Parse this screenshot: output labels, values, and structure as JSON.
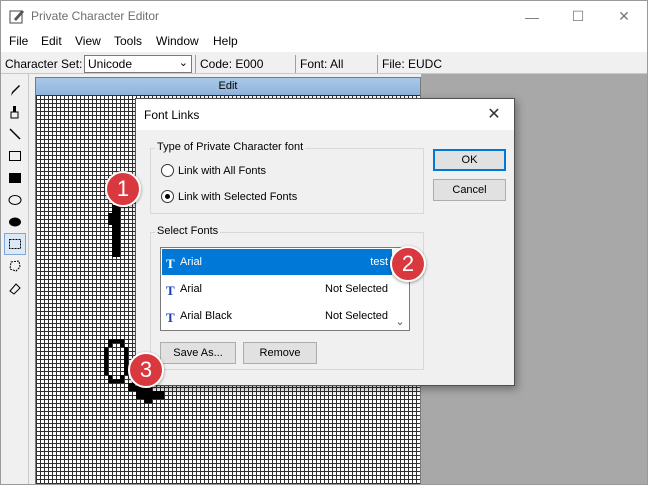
{
  "window": {
    "title": "Private Character Editor",
    "controls": {
      "minimize": "—",
      "maximize": "☐",
      "close": "✕"
    }
  },
  "menu": [
    "File",
    "Edit",
    "View",
    "Tools",
    "Window",
    "Help"
  ],
  "status_bar": {
    "charset_label": "Character Set:",
    "charset_value": "Unicode",
    "code": "Code: E000",
    "font": "Font: All",
    "file": "File: EUDC"
  },
  "tools": [
    "pencil-icon",
    "brush-icon",
    "line-icon",
    "hollow-rectangle-icon",
    "filled-rectangle-icon",
    "hollow-ellipse-icon",
    "filled-ellipse-icon",
    "rectangular-selection-icon",
    "freeform-selection-icon",
    "eraser-icon"
  ],
  "editor": {
    "header": "Edit"
  },
  "dialog": {
    "title": "Font Links",
    "close": "✕",
    "type_group": {
      "legend": "Type of Private Character font",
      "options": [
        "Link with All Fonts",
        "Link with Selected Fonts"
      ],
      "selected": "Link with Selected Fonts"
    },
    "select_group": {
      "legend": "Select Fonts",
      "fonts": [
        {
          "name": "Arial",
          "status": "test"
        },
        {
          "name": "Arial",
          "status": "Not Selected"
        },
        {
          "name": "Arial Black",
          "status": "Not Selected"
        }
      ],
      "save_as": "Save As...",
      "remove": "Remove"
    },
    "ok": "OK",
    "cancel": "Cancel"
  },
  "callouts": [
    "1",
    "2",
    "3"
  ],
  "colors": {
    "selection": "#0078d7",
    "callout": "#d9393e",
    "grey_background": "#a8a8a8"
  }
}
